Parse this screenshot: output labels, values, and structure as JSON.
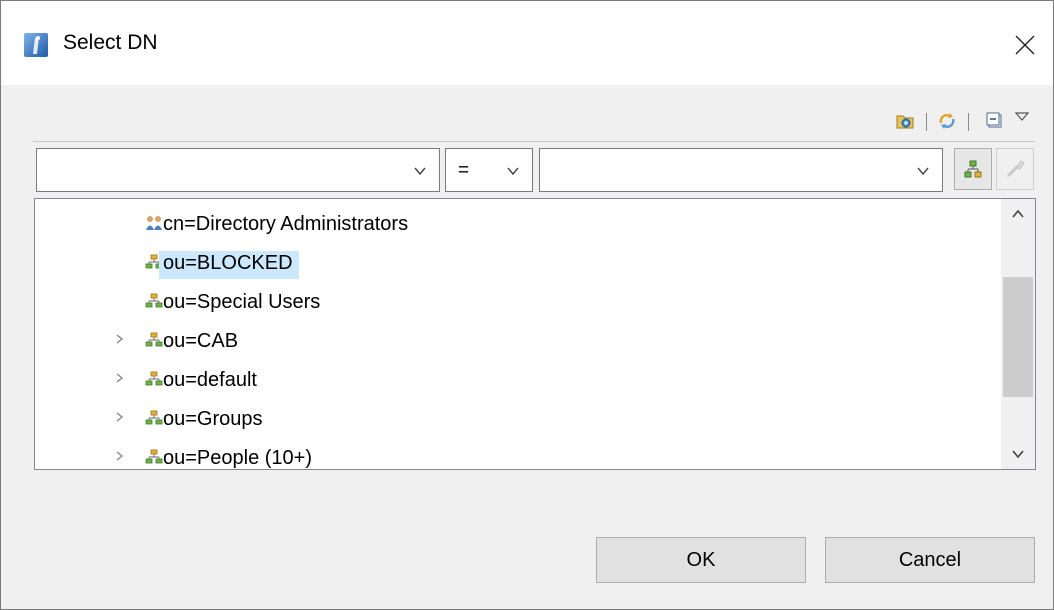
{
  "window": {
    "title": "Select DN",
    "close_icon": "close-icon"
  },
  "toolbar": {
    "icons": [
      "goto-dn-icon",
      "refresh-icon",
      "collapse-all-icon",
      "view-menu-icon"
    ]
  },
  "filter": {
    "attribute_value": "",
    "operator_value": "=",
    "value_value": "",
    "apply_icon": "tree-search-icon",
    "clear_icon": "clear-filter-icon"
  },
  "tree": {
    "items": [
      {
        "label": "cn=Directory Administrators",
        "icon": "group-icon",
        "expandable": false,
        "selected": false
      },
      {
        "label": "ou=BLOCKED",
        "icon": "ou-icon",
        "expandable": false,
        "selected": true
      },
      {
        "label": "ou=Special Users",
        "icon": "ou-icon",
        "expandable": false,
        "selected": false
      },
      {
        "label": "ou=CAB",
        "icon": "ou-icon",
        "expandable": true,
        "selected": false
      },
      {
        "label": "ou=default",
        "icon": "ou-icon",
        "expandable": true,
        "selected": false
      },
      {
        "label": "ou=Groups",
        "icon": "ou-icon",
        "expandable": true,
        "selected": false
      },
      {
        "label": "ou=People (10+)",
        "icon": "ou-icon",
        "expandable": true,
        "selected": false
      }
    ]
  },
  "buttons": {
    "ok_label": "OK",
    "cancel_label": "Cancel"
  },
  "colors": {
    "selection": "#cce8ff",
    "accent": "#3a7bd5"
  }
}
